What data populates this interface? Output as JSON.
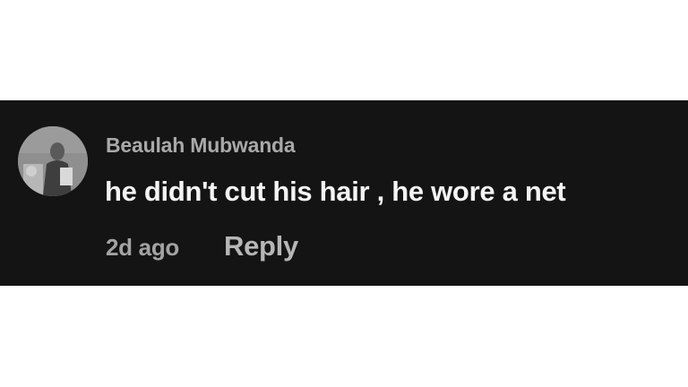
{
  "comment": {
    "author": "Beaulah Mubwanda",
    "text": "he didn't cut his hair , he wore a net",
    "timestamp": "2d ago",
    "reply_label": "Reply",
    "avatar_icon": "user-avatar-photo"
  },
  "colors": {
    "card_background": "#141414",
    "page_background": "#ffffff",
    "author_text": "#a9a9a9",
    "comment_text": "#f4f4f4",
    "meta_text": "#a3a3a3",
    "reply_text": "#b6b6b6"
  }
}
